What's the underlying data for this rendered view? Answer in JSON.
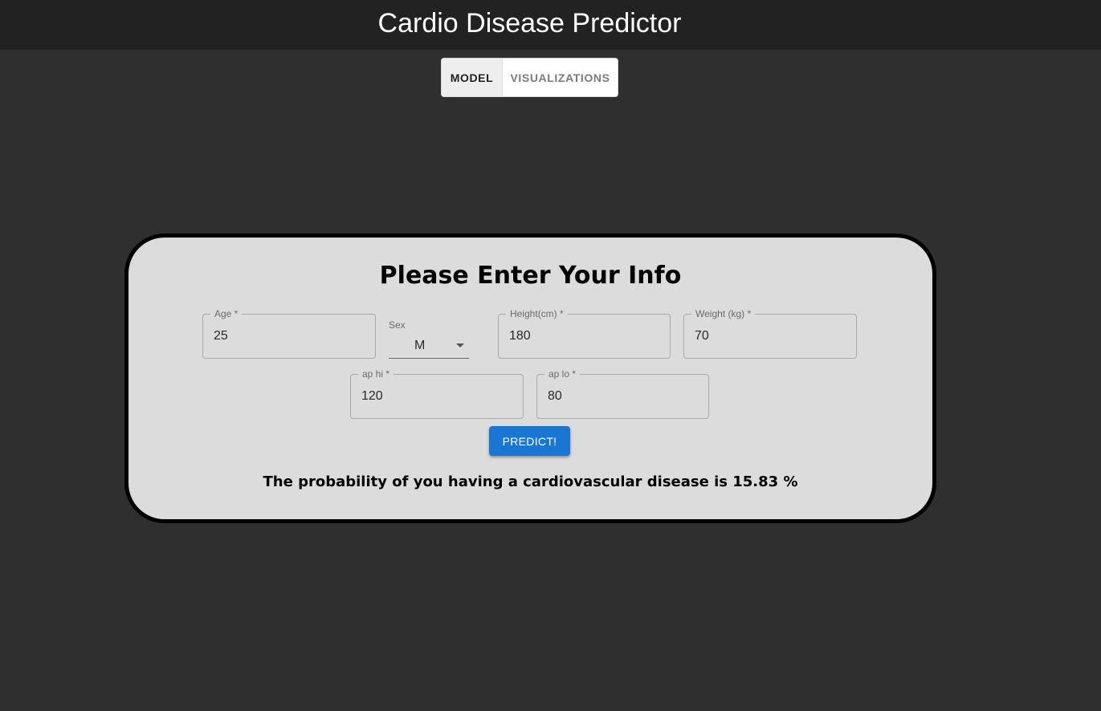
{
  "header": {
    "title": "Cardio Disease Predictor"
  },
  "tabs": [
    {
      "label": "MODEL",
      "selected": true
    },
    {
      "label": "VISUALIZATIONS",
      "selected": false
    }
  ],
  "form": {
    "title": "Please Enter Your Info",
    "age": {
      "label": "Age *",
      "value": "25"
    },
    "sex": {
      "label": "Sex",
      "value": "M"
    },
    "height": {
      "label": "Height(cm) *",
      "value": "180"
    },
    "weight": {
      "label": "Weight (kg) *",
      "value": "70"
    },
    "ap_hi": {
      "label": "ap hi *",
      "value": "120"
    },
    "ap_lo": {
      "label": "ap lo *",
      "value": "80"
    },
    "predict_label": "PREDICT!"
  },
  "result": {
    "text": "The probability of you having a cardiovascular disease is 15.83 %"
  },
  "colors": {
    "background": "#2f2f2f",
    "header": "#222222",
    "card": "#dcdcdc",
    "accent": "#1976d2"
  }
}
